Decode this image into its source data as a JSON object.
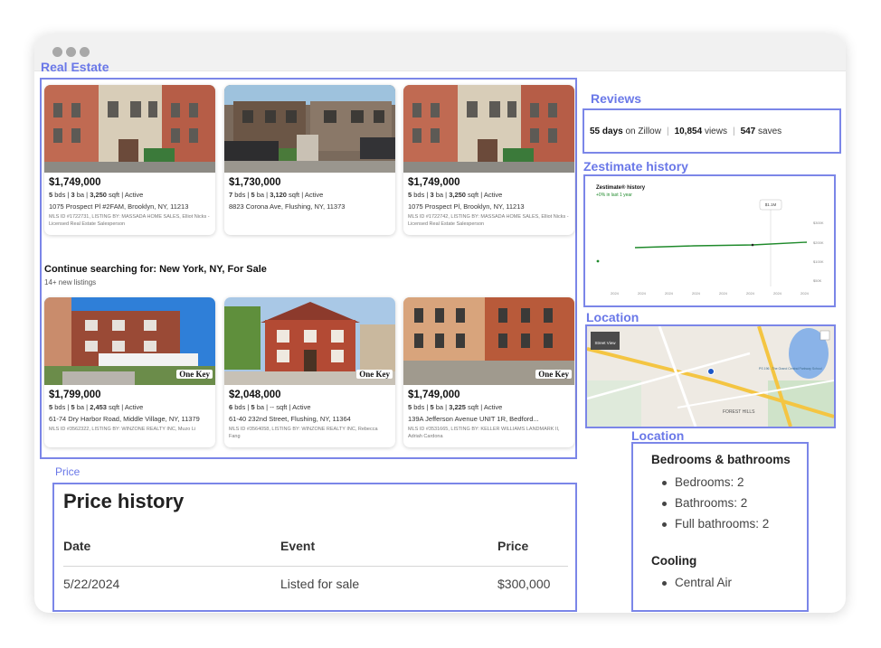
{
  "labels": {
    "real_estate": "Real Estate",
    "reviews": "Reviews",
    "zestimate": "Zestimate history",
    "location_map": "Location",
    "location_facts": "Location",
    "price": "Price"
  },
  "top_listings": [
    {
      "price": "$1,749,000",
      "bds": "5",
      "ba": "3",
      "sqft": "3,250",
      "status": "Active",
      "address": "1075 Prospect Pl #2FAM, Brooklyn, NY, 11213",
      "mls_line1": "MLS ID #1722731, LISTING BY: MASSADA HOME SALES, Elliot Nicks -",
      "mls_line2": "Licensed Real Estate Salesperson"
    },
    {
      "price": "$1,730,000",
      "bds": "7",
      "ba": "5",
      "sqft": "3,120",
      "status": "Active",
      "address": "8823 Corona Ave, Flushing, NY, 11373",
      "mls_line1": "",
      "mls_line2": ""
    },
    {
      "price": "$1,749,000",
      "bds": "5",
      "ba": "3",
      "sqft": "3,250",
      "status": "Active",
      "address": "1075 Prospect Pl, Brooklyn, NY, 11213",
      "mls_line1": "MLS ID #1722742, LISTING BY: MASSADA HOME SALES, Elliot Nicks -",
      "mls_line2": "Licensed Real Estate Salesperson"
    }
  ],
  "continue": {
    "title": "Continue searching for: New York, NY, For Sale",
    "subtitle": "14+ new listings"
  },
  "bottom_listings": [
    {
      "price": "$1,799,000",
      "bds": "5",
      "ba": "5",
      "sqft": "2,453",
      "status": "Active",
      "address": "61-74 Dry Harbor Road, Middle Village, NY, 11379",
      "mls_line1": "MLS ID #3562322, LISTING BY: WINZONE REALTY INC, Muzo Li",
      "mls_line2": "",
      "badge": "One Key"
    },
    {
      "price": "$2,048,000",
      "bds": "6",
      "ba": "5",
      "sqft": "--",
      "status": "Active",
      "address": "61-40 232nd Street, Flushing, NY, 11364",
      "mls_line1": "MLS ID #3564058, LISTING BY: WINZONE REALTY INC, Rebecca",
      "mls_line2": "Fang",
      "badge": "One Key"
    },
    {
      "price": "$1,749,000",
      "bds": "5",
      "ba": "5",
      "sqft": "3,225",
      "status": "Active",
      "address": "139A Jefferson Avenue UNIT 1R, Bedford...",
      "mls_line1": "MLS ID #3531665, LISTING BY: KELLER WILLIAMS LANDMARK II,",
      "mls_line2": "Adriah Cardona",
      "badge": "One Key"
    }
  ],
  "reviews": {
    "days": "55 days",
    "days_suffix": "on Zillow",
    "views": "10,854",
    "views_suffix": "views",
    "saves": "547",
    "saves_suffix": "saves"
  },
  "zestimate_chart": {
    "title": "Zestimate® history",
    "change": "+0% in last 1 year",
    "tooltip": "$1.1M",
    "y_ticks": [
      "$300K",
      "$200K",
      "$100K",
      "$50K"
    ],
    "x_ticks": [
      "2024",
      "2024",
      "2024",
      "2024",
      "2024",
      "2024",
      "2024",
      "2024"
    ],
    "line_color": "#1f8a2b"
  },
  "map": {
    "street_view": "Street View",
    "forest_hills": "FOREST HILLS",
    "school": "PS 196 - The Grand Central Parkway School"
  },
  "price_history": {
    "title": "Price history",
    "headers": [
      "Date",
      "Event",
      "Price"
    ],
    "rows": [
      {
        "date": "5/22/2024",
        "event": "Listed for sale",
        "price": "$300,000"
      }
    ]
  },
  "facts": {
    "bed_bath_title": "Bedrooms & bathrooms",
    "bedrooms": "Bedrooms: 2",
    "bathrooms": "Bathrooms: 2",
    "full_bathrooms": "Full bathrooms: 2",
    "cooling_title": "Cooling",
    "cooling": "Central Air"
  },
  "colors": {
    "accent": "#7b86e8",
    "label": "#6a78e8"
  }
}
